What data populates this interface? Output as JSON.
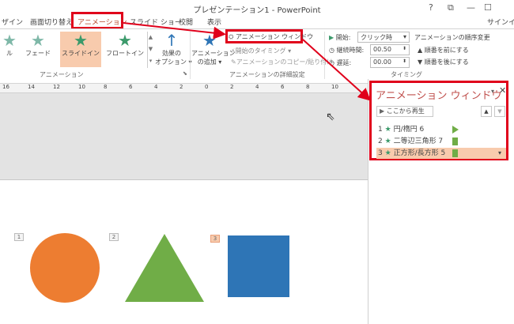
{
  "window": {
    "title": "プレゼンテーション1 - PowerPoint",
    "help": "?",
    "restore": "⧉",
    "minimize": "—",
    "maximize": "☐",
    "signin": "サインイン"
  },
  "tabs": [
    "ザイン",
    "画面切り替え",
    "アニメーション",
    "スライド ショー",
    "校閲",
    "表示"
  ],
  "effects": [
    {
      "label": "ル"
    },
    {
      "label": "フェード"
    },
    {
      "label": "スライドイン"
    },
    {
      "label": "フロートイン"
    }
  ],
  "effect_options": {
    "line1": "効果の",
    "line2": "オプション ▾"
  },
  "add_animation": {
    "line1": "アニメーション",
    "line2": "の追加 ▾"
  },
  "anim_pane_button": "アニメーション ウィンドウ",
  "trigger": "開始のタイミング ▾",
  "painter": "アニメーションのコピー/貼り付け",
  "timing": {
    "start_label": "開始:",
    "start_value": "クリック時",
    "duration_label": "継続時間:",
    "duration_value": "00.50",
    "delay_label": "遅延:",
    "delay_value": "00.00",
    "reorder_title": "アニメーションの順序変更",
    "earlier": "▲ 順番を前にする",
    "later": "▼ 順番を後にする"
  },
  "group_labels": {
    "animation": "アニメーション",
    "advanced": "アニメーションの詳細設定",
    "timing": "タイミング"
  },
  "ruler_ticks": [
    "16",
    "14",
    "12",
    "10",
    "8",
    "6",
    "4",
    "2",
    "0",
    "2",
    "4",
    "6",
    "8",
    "10"
  ],
  "pane": {
    "title": "アニメーション ウィンドウ",
    "play": "ここから再生",
    "items": [
      {
        "num": "1",
        "name": "円/楕円 6"
      },
      {
        "num": "2",
        "name": "二等辺三角形 7"
      },
      {
        "num": "3",
        "name": "正方形/長方形 5"
      }
    ]
  },
  "slide_tags": [
    "1",
    "2",
    "3"
  ],
  "colors": {
    "accent": "#e0001b",
    "circle": "#ed7d31",
    "triangle": "#70ad47",
    "square": "#2e75b6",
    "pane_title": "#c0504d",
    "selected": "#f8cbad"
  }
}
